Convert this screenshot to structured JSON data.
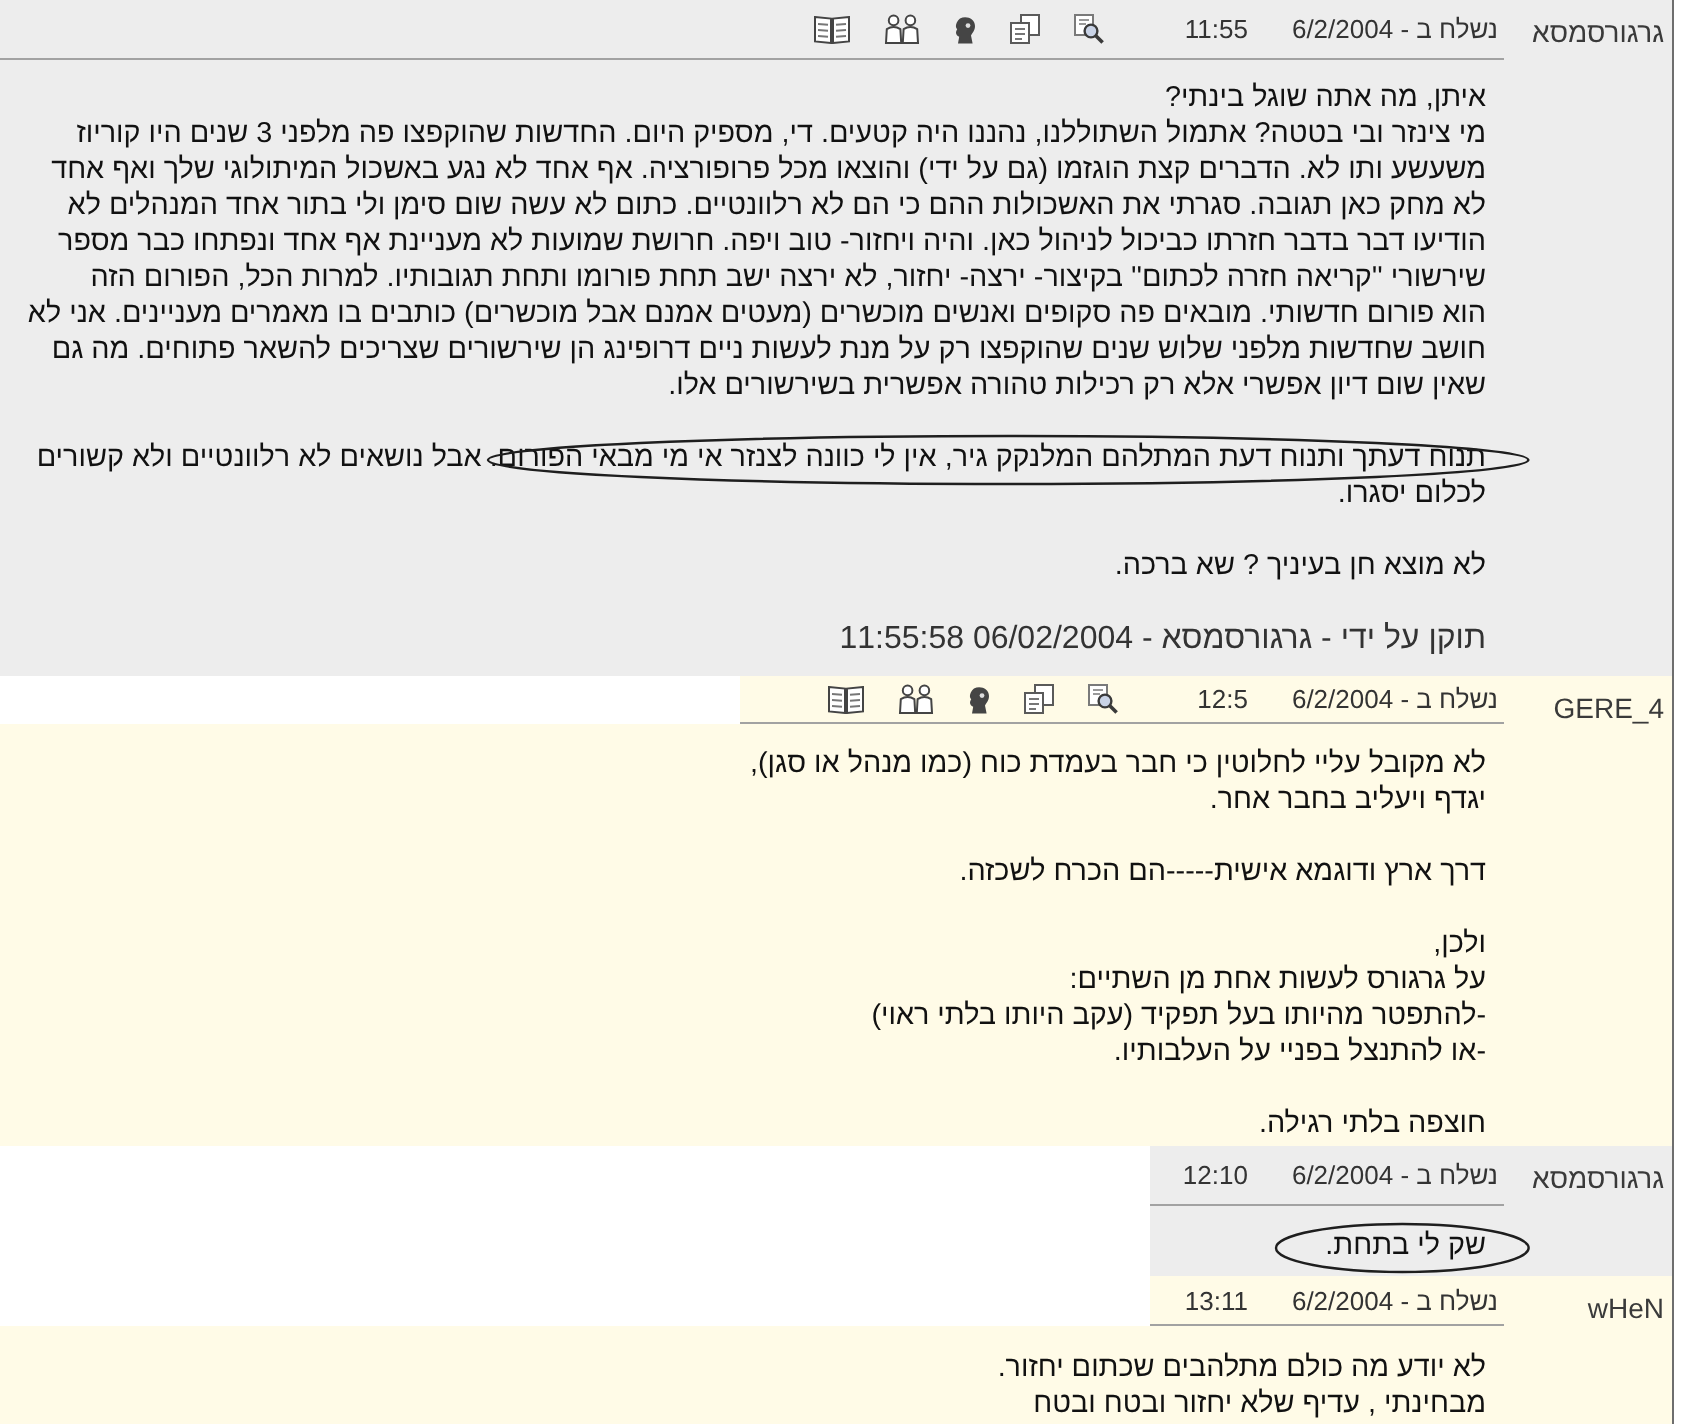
{
  "posts": [
    {
      "author": "גרגורסמסא",
      "sent": "נשלח ב - 6/2/2004",
      "time": "11:55",
      "color": "#ededed",
      "tools": true,
      "paragraphs": [
        {
          "segments": [
            {
              "text": "איתן, מה אתה שוגל בינתי?\nמי צינזר ובי בטטה? אתמול השתוללנו, נהננו היה קטעים. די, מספיק היום. החדשות שהוקפצו פה מלפני 3 שנים היו קוריוז\nמשעשע ותו לא. הדברים קצת הוגזמו (גם על ידי) והוצאו מכל פרופורציה. אף אחד לא נגע באשכול המיתולוגי שלך ואף אחד\nלא מחק כאן תגובה. סגרתי את האשכולות ההם כי הם לא רלוונטיים. כתום לא עשה שום סימן ולי בתור אחד המנהלים לא\nהודיעו דבר בדבר חזרתו כביכול לניהול כאן. והיה ויחזור- טוב ויפה. חרושת שמועות לא מעניינת אף אחד ונפתחו כבר מספר\nשירשורי ''קריאה חזרה לכתום'' בקיצור- ירצה- יחזור, לא ירצה ישב תחת פורומו ותחת תגובותיו. למרות הכל, הפורום הזה\nהוא פורום חדשותי. מובאים פה סקופים ואנשים מוכשרים (מעטים אמנם אבל מוכשרים) כותבים בו מאמרים מעניינים. אני לא\nחושב שחדשות מלפני שלוש שנים שהוקפצו רק על מנת לעשות ניים דרופינג הן שירשורים שצריכים להשאר פתוחים. מה גם\nשאין שום דיון אפשרי אלא רק רכילות טהורה אפשרית בשירשורים אלו.",
              "circled": false
            }
          ]
        },
        {
          "segments": [
            {
              "text": "תנוח דעתך ותנוח דעת המתלהם המלנקק גיר, אין לי כוונה לצנזר אי מי מבאי הפורום.",
              "circled": true
            },
            {
              "text": " אבל נושאים לא רלוונטיים ולא קשורים\nלכלום יסגרו.",
              "circled": false
            }
          ]
        },
        {
          "segments": [
            {
              "text": "לא מוצא חן בעיניך ? שא ברכה.",
              "circled": false
            }
          ]
        }
      ],
      "edited": "תוקן על ידי - גרגורסמסא - 06/02/2004 11:55:58"
    },
    {
      "author": "GERE_4",
      "sent": "נשלח ב - 6/2/2004",
      "time": "12:5",
      "color": "#fffbe7",
      "tools": true,
      "paragraphs": [
        {
          "segments": [
            {
              "text": "לא מקובל עליי לחלוטין כי חבר בעמדת כוח (כמו מנהל או סגן),\nיגדף ויעליב בחבר אחר.",
              "circled": false
            }
          ]
        },
        {
          "segments": [
            {
              "text": "דרך ארץ ודוגמא אישית-----הם הכרח לשכזה.",
              "circled": false
            }
          ]
        },
        {
          "segments": [
            {
              "text": "ולכן,\nעל גרגורס לעשות אחת מן השתיים:\n-להתפטר מהיותו בעל תפקיד (עקב היותו בלתי ראוי)\n-או להתנצל בפניי על העלבותיו.",
              "circled": false
            }
          ]
        },
        {
          "segments": [
            {
              "text": "חוצפה בלתי רגילה.",
              "circled": false
            }
          ]
        }
      ]
    },
    {
      "author": "גרגורסמסא",
      "sent": "נשלח ב - 6/2/2004",
      "time": "12:10",
      "color": "#ededed",
      "tools": false,
      "paragraphs": [
        {
          "segments": [
            {
              "text": "שק לי בתחת.",
              "circled": true
            }
          ]
        }
      ]
    },
    {
      "author": "wHeN",
      "sent": "נשלח ב - 6/2/2004",
      "time": "13:11",
      "color": "#fffbe7",
      "tools": false,
      "paragraphs": [
        {
          "segments": [
            {
              "text": "לא יודע מה כולם מתלהבים שכתום יחזור.\nמבחינתי , עדיף שלא יחזור ובטח ובטח",
              "circled": false
            }
          ]
        }
      ]
    }
  ]
}
